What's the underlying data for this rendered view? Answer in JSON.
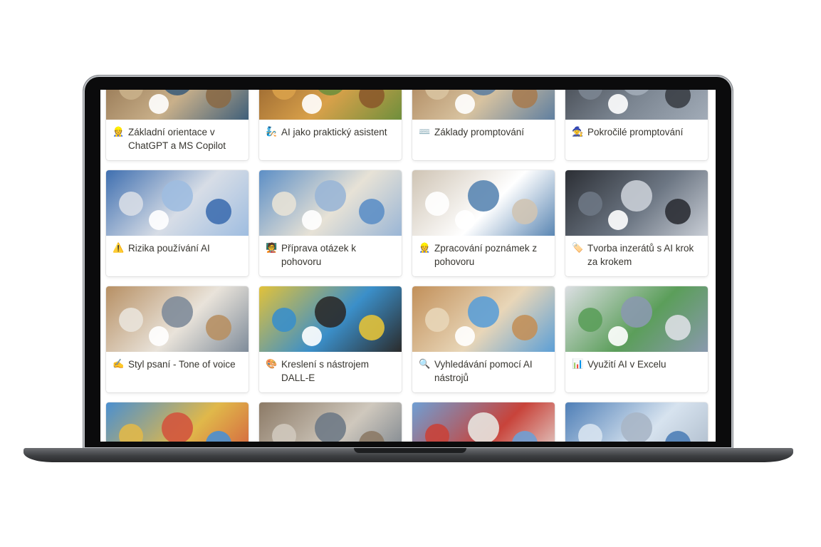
{
  "cards": [
    {
      "emoji": "👷",
      "title": "Základní orientace v ChatGPT a MS Copilot",
      "thumb_colors": [
        "#8a6a47",
        "#c9b08a",
        "#3f5f7a"
      ]
    },
    {
      "emoji": "🧞",
      "title": "AI jako praktický asistent",
      "thumb_colors": [
        "#8b5a2b",
        "#d9a14a",
        "#6f8f3c"
      ]
    },
    {
      "emoji": "⌨️",
      "title": "Základy promptování",
      "thumb_colors": [
        "#a67c52",
        "#d8c3a0",
        "#5f7fa0"
      ]
    },
    {
      "emoji": "🧙",
      "title": "Pokročilé promptování",
      "thumb_colors": [
        "#3b3f46",
        "#7b8591",
        "#a2acb8"
      ]
    },
    {
      "emoji": "⚠️",
      "title": "Rizika používání AI",
      "thumb_colors": [
        "#3f6fb0",
        "#d7dde6",
        "#9fbde0"
      ]
    },
    {
      "emoji": "🧑‍🏫",
      "title": "Příprava otázek k pohovoru",
      "thumb_colors": [
        "#5d8fc6",
        "#e7e2d6",
        "#9ab6d6"
      ]
    },
    {
      "emoji": "👷",
      "title": "Zpracování poznámek z pohovoru",
      "thumb_colors": [
        "#cfc4b4",
        "#ffffff",
        "#5a86b3"
      ]
    },
    {
      "emoji": "🏷️",
      "title": "Tvorba inzerátů s AI krok za krokem",
      "thumb_colors": [
        "#2c2f35",
        "#6d7784",
        "#c9ced6"
      ]
    },
    {
      "emoji": "✍️",
      "title": "Styl psaní - Tone of voice",
      "thumb_colors": [
        "#b79064",
        "#e9e3da",
        "#7f8c9a"
      ]
    },
    {
      "emoji": "🎨",
      "title": "Kreslení s nástrojem DALL-E",
      "thumb_colors": [
        "#e2c23a",
        "#3b8fc9",
        "#2b2b2b"
      ]
    },
    {
      "emoji": "🔍",
      "title": "Vyhledávání pomocí AI nástrojů",
      "thumb_colors": [
        "#c2905a",
        "#e8d6b8",
        "#5c9fd6"
      ]
    },
    {
      "emoji": "📊",
      "title": "Využití AI v Excelu",
      "thumb_colors": [
        "#dcdfe3",
        "#5b9e5a",
        "#8a99ae"
      ]
    },
    {
      "emoji": "",
      "title": "",
      "thumb_colors": [
        "#4a8fd0",
        "#e0b84a",
        "#d2553e"
      ]
    },
    {
      "emoji": "",
      "title": "",
      "thumb_colors": [
        "#8c7a66",
        "#cfc8bd",
        "#6f7a86"
      ]
    },
    {
      "emoji": "",
      "title": "",
      "thumb_colors": [
        "#6f9fd4",
        "#c8433a",
        "#e7e4df"
      ]
    },
    {
      "emoji": "",
      "title": "",
      "thumb_colors": [
        "#4f7fb7",
        "#d7e3ef",
        "#a8b6c6"
      ]
    }
  ]
}
